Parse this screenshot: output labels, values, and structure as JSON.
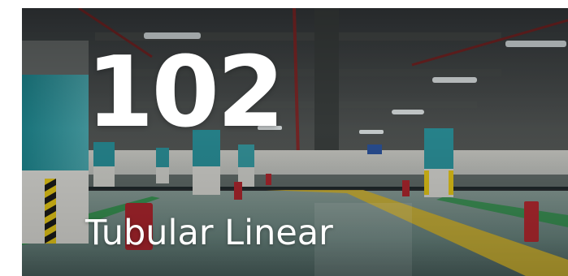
{
  "card": {
    "number": "102",
    "title": "Tubular Linear"
  }
}
